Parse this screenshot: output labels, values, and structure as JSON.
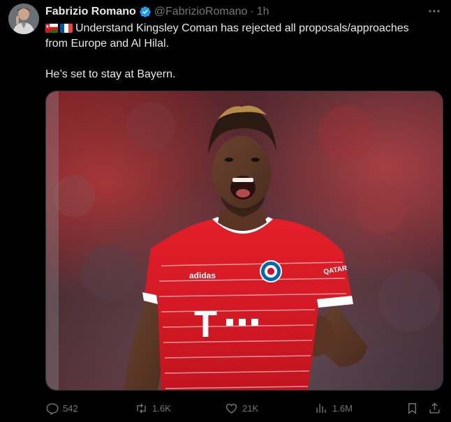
{
  "author": {
    "display_name": "Fabrizio Romano",
    "handle": "@FabrizioRomano",
    "separator": "·",
    "time": "1h",
    "verified_badge_color": "#1d9bf0"
  },
  "tweet": {
    "line1": "Understand Kingsley Coman has rejected all proposals/approaches",
    "line2": "from Europe and Al Hilal.",
    "line3": "He’s set to stay at Bayern."
  },
  "media": {
    "jersey_sponsor_letter": "T",
    "jersey_brand": "adidas",
    "jersey_sleeve": "QATAR"
  },
  "actions": {
    "replies": "542",
    "retweets": "1.6K",
    "likes": "21K",
    "views": "1.6M"
  },
  "icons": {
    "reply": "reply-icon",
    "retweet": "retweet-icon",
    "like": "heart-icon",
    "views": "views-chart-icon",
    "bookmark": "bookmark-icon",
    "share": "share-icon",
    "more": "more-icon"
  },
  "colors": {
    "background": "#000000",
    "text": "#e7e9ea",
    "muted": "#71767b",
    "accent": "#1d9bf0"
  }
}
